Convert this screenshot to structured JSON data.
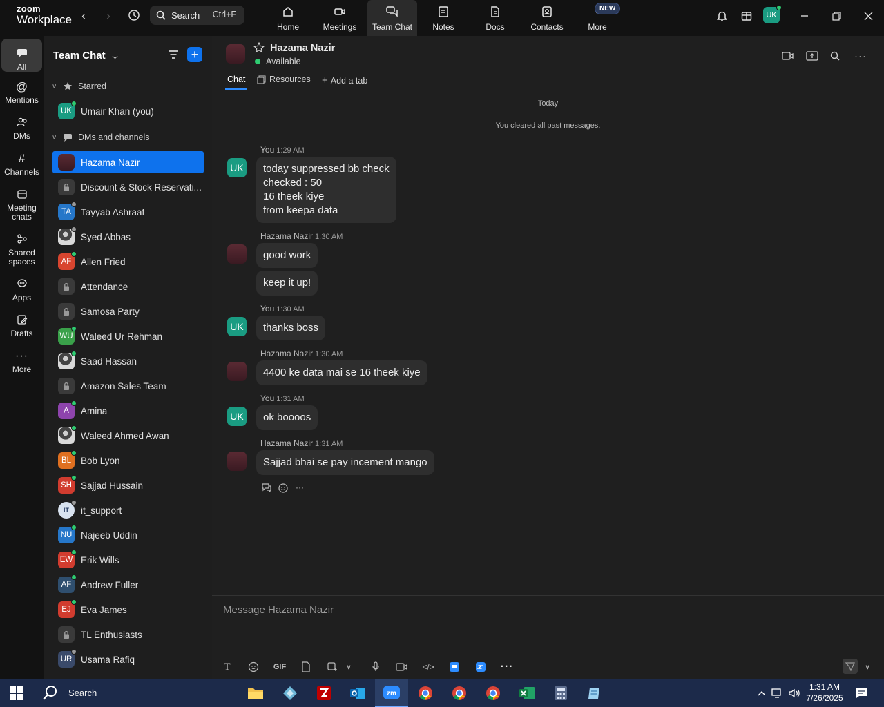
{
  "app": {
    "logo_line1": "zoom",
    "logo_line2": "Workplace",
    "search_label": "Search",
    "search_hotkey": "Ctrl+F",
    "tabs": [
      {
        "label": "Home",
        "icon": "home-icon"
      },
      {
        "label": "Meetings",
        "icon": "video-camera-icon"
      },
      {
        "label": "Team Chat",
        "icon": "chat-bubbles-icon"
      },
      {
        "label": "Notes",
        "icon": "notes-icon"
      },
      {
        "label": "Docs",
        "icon": "docs-icon"
      },
      {
        "label": "Contacts",
        "icon": "contacts-icon"
      },
      {
        "label": "More",
        "icon": "more-dots-icon"
      }
    ],
    "active_tab": "Team Chat",
    "new_badge": "NEW",
    "user_initials": "UK",
    "accent_color": "#0e72ed"
  },
  "rail": [
    {
      "label": "All",
      "icon": "chat-icon"
    },
    {
      "label": "Mentions",
      "icon": "at-icon"
    },
    {
      "label": "DMs",
      "icon": "people-icon"
    },
    {
      "label": "Channels",
      "icon": "hash-icon"
    },
    {
      "label": "Meeting chats",
      "icon": "calendar-icon"
    },
    {
      "label": "Shared spaces",
      "icon": "share-icon"
    },
    {
      "label": "Apps",
      "icon": "apps-icon"
    },
    {
      "label": "Drafts",
      "icon": "drafts-icon"
    },
    {
      "label": "More",
      "icon": "ellipsis-icon"
    }
  ],
  "list": {
    "title": "Team Chat",
    "starred_label": "Starred",
    "dms_label": "DMs and channels",
    "starred": [
      {
        "name": "Umair Khan (you)",
        "initials": "UK",
        "color": "#1a9c82",
        "status": "online"
      }
    ],
    "items": [
      {
        "name": "Hazama Nazir",
        "initials": "",
        "color": "#4a2028",
        "status": "none",
        "type": "maroon"
      },
      {
        "name": "Discount & Stock Reservati...",
        "initials": "",
        "color": "#3a3a3a",
        "status": "none",
        "type": "lock"
      },
      {
        "name": "Tayyab Ashraaf",
        "initials": "TA",
        "color": "#2677c9",
        "status": "offline"
      },
      {
        "name": "Syed Abbas",
        "initials": "",
        "color": "#333",
        "status": "offline",
        "type": "photo"
      },
      {
        "name": "Allen Fried",
        "initials": "AF",
        "color": "#d8452f",
        "status": "online"
      },
      {
        "name": "Attendance",
        "initials": "",
        "color": "#3a3a3a",
        "status": "none",
        "type": "lock"
      },
      {
        "name": "Samosa Party",
        "initials": "",
        "color": "#3a3a3a",
        "status": "none",
        "type": "lock"
      },
      {
        "name": "Waleed Ur Rehman",
        "initials": "WU",
        "color": "#3aa14a",
        "status": "online"
      },
      {
        "name": "Saad Hassan",
        "initials": "",
        "color": "#333",
        "status": "online",
        "type": "photo"
      },
      {
        "name": "Amazon Sales Team",
        "initials": "",
        "color": "#3a3a3a",
        "status": "none",
        "type": "lock"
      },
      {
        "name": "Amina",
        "initials": "A",
        "color": "#8e44ad",
        "status": "online"
      },
      {
        "name": "Waleed Ahmed Awan",
        "initials": "",
        "color": "#333",
        "status": "online",
        "type": "photo"
      },
      {
        "name": "Bob Lyon",
        "initials": "BL",
        "color": "#e07020",
        "status": "online"
      },
      {
        "name": "Sajjad Hussain",
        "initials": "SH",
        "color": "#d13c2f",
        "status": "online"
      },
      {
        "name": "it_support",
        "initials": "IT",
        "color": "#d9e3f0",
        "status": "offline",
        "type": "it"
      },
      {
        "name": "Najeeb Uddin",
        "initials": "NU",
        "color": "#2677c9",
        "status": "online"
      },
      {
        "name": "Erik Wills",
        "initials": "EW",
        "color": "#d13c2f",
        "status": "online"
      },
      {
        "name": "Andrew Fuller",
        "initials": "AF",
        "color": "#2f4f6f",
        "status": "online"
      },
      {
        "name": "Eva James",
        "initials": "EJ",
        "color": "#d13c2f",
        "status": "online"
      },
      {
        "name": "TL Enthusiasts",
        "initials": "",
        "color": "#3a3a3a",
        "status": "none",
        "type": "lock"
      },
      {
        "name": "Usama Rafiq",
        "initials": "UR",
        "color": "#3a4a6a",
        "status": "offline"
      }
    ]
  },
  "chat": {
    "name": "Hazama Nazir",
    "status": "Available",
    "tabs": [
      "Chat",
      "Resources",
      "Add a tab"
    ],
    "day_label": "Today",
    "system_msg": "You cleared all past messages.",
    "messages": [
      {
        "sender": "You",
        "time": "1:29 AM",
        "me": true,
        "bubbles": [
          "today suppressed bb check\nchecked : 50\n16 theek kiye\nfrom keepa data"
        ]
      },
      {
        "sender": "Hazama Nazir",
        "time": "1:30 AM",
        "me": false,
        "bubbles": [
          "good work",
          "keep it up!"
        ]
      },
      {
        "sender": "You",
        "time": "1:30 AM",
        "me": true,
        "bubbles": [
          "thanks boss"
        ]
      },
      {
        "sender": "Hazama Nazir",
        "time": "1:30 AM",
        "me": false,
        "bubbles": [
          "4400 ke data mai se 16 theek kiye"
        ]
      },
      {
        "sender": "You",
        "time": "1:31 AM",
        "me": true,
        "bubbles": [
          "ok boooos"
        ]
      },
      {
        "sender": "Hazama Nazir",
        "time": "1:31 AM",
        "me": false,
        "bubbles": [
          "Sajjad bhai se pay incement mango"
        ]
      }
    ],
    "composer_placeholder": "Message Hazama Nazir",
    "composer_gif": "GIF"
  },
  "taskbar": {
    "search_label": "Search",
    "time": "1:31 AM",
    "date": "7/26/2025"
  }
}
